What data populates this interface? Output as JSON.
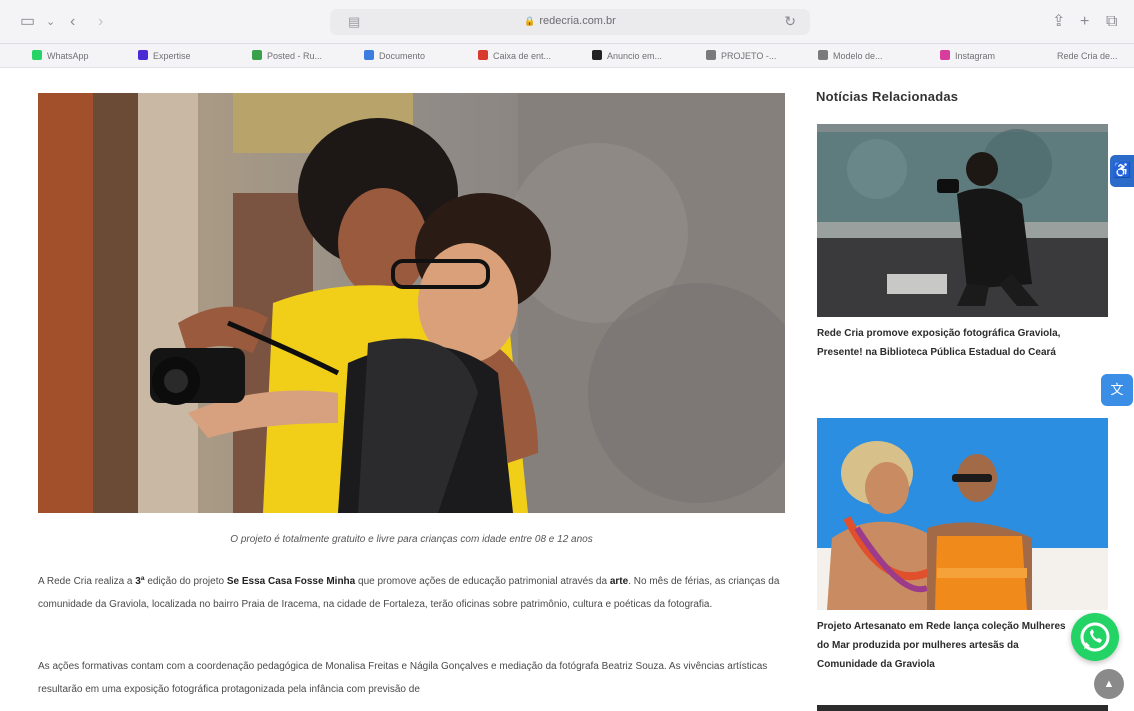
{
  "browser": {
    "url": "redecria.com.br",
    "favorites": [
      {
        "label": "WhatsApp",
        "color": "#25d366"
      },
      {
        "label": "Expertise",
        "color": "#4b2bd6"
      },
      {
        "label": "Posted - Ru...",
        "color": "#3aa14b"
      },
      {
        "label": "Documento",
        "color": "#3d7de0"
      },
      {
        "label": "Caixa de ent...",
        "color": "#d93a2e"
      },
      {
        "label": "Anuncio em...",
        "color": "#222222"
      },
      {
        "label": "PROJETO -...",
        "color": "#7a7a7a"
      },
      {
        "label": "Modelo de...",
        "color": "#7a7a7a"
      },
      {
        "label": "Instagram",
        "color": "#d83c9c"
      },
      {
        "label": "Rede Cria de...",
        "color": "#f4f4f6"
      }
    ]
  },
  "article": {
    "caption": "O projeto é totalmente gratuito e livre para crianças com idade entre 08 e 12 anos",
    "p1": {
      "a": "A Rede Cria realiza a ",
      "b": "3ª",
      "c": " edição do projeto ",
      "d": "Se Essa Casa Fosse Minha",
      "e": " que promove ações de educação patrimonial através da ",
      "f": "arte",
      "g": ". No mês de férias, as crianças da comunidade da Graviola, localizada no bairro Praia de Iracema, na cidade de Fortaleza, terão oficinas sobre patrimônio, cultura e poéticas da fotografia."
    },
    "p2": "As ações formativas contam com a coordenação pedagógica de Monalisa Freitas e Nágila Gonçalves e mediação da fotógrafa Beatriz Souza. As vivências artísticas resultarão em uma exposição fotográfica protagonizada pela infância com previsão de"
  },
  "sidebar": {
    "title": "Notícias Relacionadas",
    "items": [
      {
        "title": "Rede Cria promove exposição fotográfica Graviola, Presente! na Biblioteca Pública Estadual do Ceará"
      },
      {
        "title": "Projeto Artesanato em Rede lança coleção Mulheres do Mar produzida por mulheres artesãs da Comunidade da Graviola"
      }
    ]
  },
  "colors": {
    "whatsapp": "#24d366",
    "accessibility": "#2c6bc9",
    "language": "#3a8ee6"
  }
}
